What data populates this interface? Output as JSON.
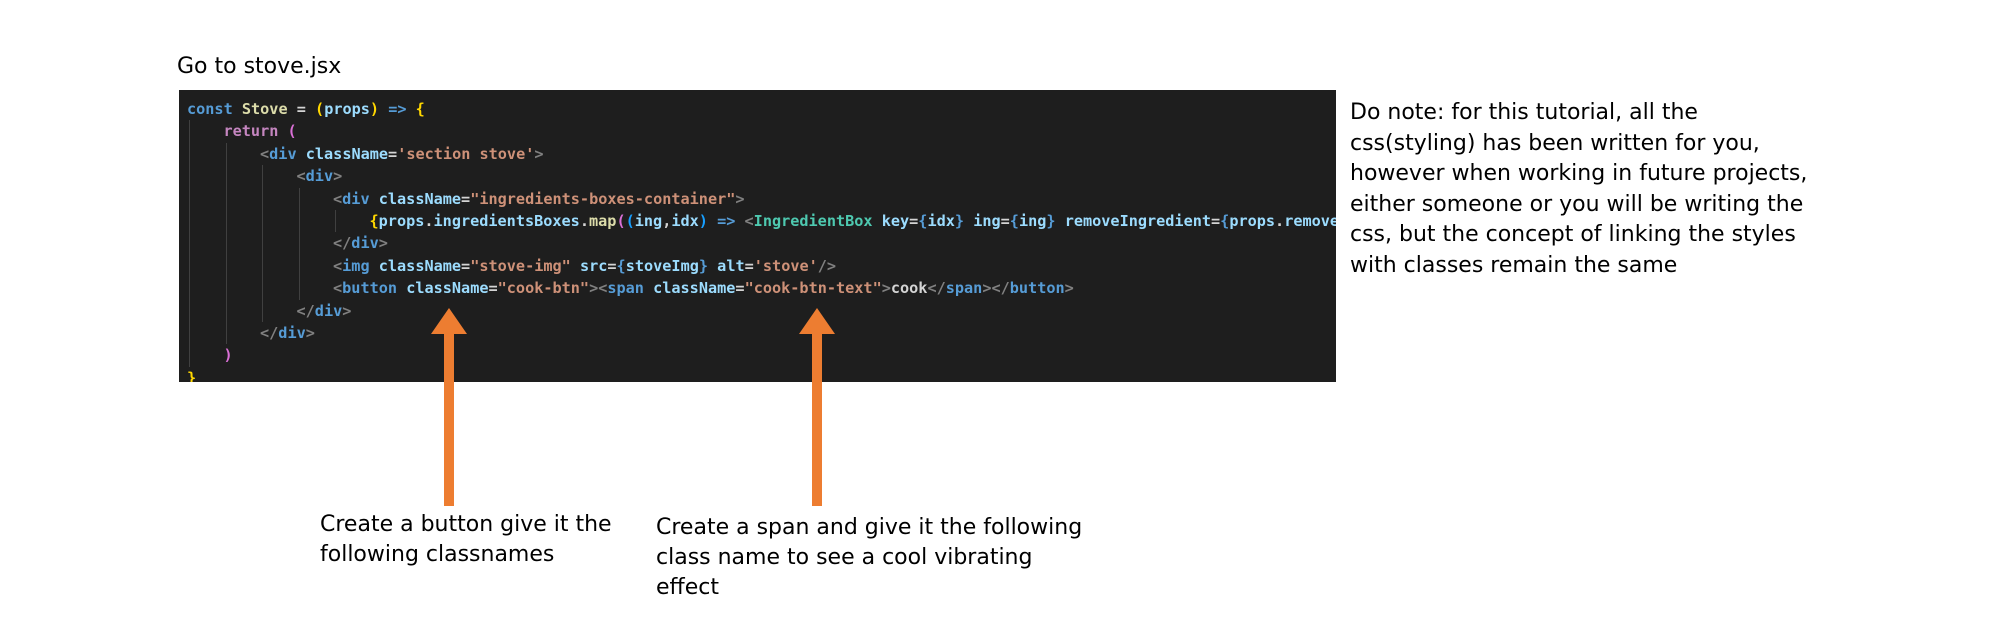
{
  "heading": "Go to stove.jsx",
  "code_lines": [
    {
      "indent": 0,
      "tokens": [
        {
          "t": "const ",
          "c": "#569cd6"
        },
        {
          "t": "Stove",
          "c": "#dcdcaa"
        },
        {
          "t": " = ",
          "c": "#d4d4d4"
        },
        {
          "t": "(",
          "c": "#ffd700"
        },
        {
          "t": "props",
          "c": "#9cdcfe"
        },
        {
          "t": ")",
          "c": "#ffd700"
        },
        {
          "t": " => ",
          "c": "#569cd6"
        },
        {
          "t": "{",
          "c": "#ffd700"
        }
      ]
    },
    {
      "indent": 1,
      "tokens": [
        {
          "t": "return",
          "c": "#c586c0"
        },
        {
          "t": " ",
          "c": "#d4d4d4"
        },
        {
          "t": "(",
          "c": "#da70d6"
        }
      ]
    },
    {
      "indent": 2,
      "tokens": [
        {
          "t": "<",
          "c": "#808080"
        },
        {
          "t": "div",
          "c": "#569cd6"
        },
        {
          "t": " ",
          "c": "#d4d4d4"
        },
        {
          "t": "className",
          "c": "#9cdcfe"
        },
        {
          "t": "=",
          "c": "#d4d4d4"
        },
        {
          "t": "'section stove'",
          "c": "#ce9178"
        },
        {
          "t": ">",
          "c": "#808080"
        }
      ]
    },
    {
      "indent": 3,
      "tokens": [
        {
          "t": "<",
          "c": "#808080"
        },
        {
          "t": "div",
          "c": "#569cd6"
        },
        {
          "t": ">",
          "c": "#808080"
        }
      ]
    },
    {
      "indent": 4,
      "tokens": [
        {
          "t": "<",
          "c": "#808080"
        },
        {
          "t": "div",
          "c": "#569cd6"
        },
        {
          "t": " ",
          "c": "#d4d4d4"
        },
        {
          "t": "className",
          "c": "#9cdcfe"
        },
        {
          "t": "=",
          "c": "#d4d4d4"
        },
        {
          "t": "\"ingredients-boxes-container\"",
          "c": "#ce9178"
        },
        {
          "t": ">",
          "c": "#808080"
        }
      ]
    },
    {
      "indent": 5,
      "tokens": [
        {
          "t": "{",
          "c": "#ffd700"
        },
        {
          "t": "props",
          "c": "#9cdcfe"
        },
        {
          "t": ".",
          "c": "#d4d4d4"
        },
        {
          "t": "ingredientsBoxes",
          "c": "#9cdcfe"
        },
        {
          "t": ".",
          "c": "#d4d4d4"
        },
        {
          "t": "map",
          "c": "#dcdcaa"
        },
        {
          "t": "(",
          "c": "#da70d6"
        },
        {
          "t": "(",
          "c": "#179fff"
        },
        {
          "t": "ing",
          "c": "#9cdcfe"
        },
        {
          "t": ",",
          "c": "#d4d4d4"
        },
        {
          "t": "idx",
          "c": "#9cdcfe"
        },
        {
          "t": ")",
          "c": "#179fff"
        },
        {
          "t": " => ",
          "c": "#569cd6"
        },
        {
          "t": "<",
          "c": "#808080"
        },
        {
          "t": "IngredientBox",
          "c": "#4ec9b0"
        },
        {
          "t": " ",
          "c": "#d4d4d4"
        },
        {
          "t": "key",
          "c": "#9cdcfe"
        },
        {
          "t": "=",
          "c": "#d4d4d4"
        },
        {
          "t": "{",
          "c": "#569cd6"
        },
        {
          "t": "idx",
          "c": "#9cdcfe"
        },
        {
          "t": "}",
          "c": "#569cd6"
        },
        {
          "t": " ",
          "c": "#d4d4d4"
        },
        {
          "t": "ing",
          "c": "#9cdcfe"
        },
        {
          "t": "=",
          "c": "#d4d4d4"
        },
        {
          "t": "{",
          "c": "#569cd6"
        },
        {
          "t": "ing",
          "c": "#9cdcfe"
        },
        {
          "t": "}",
          "c": "#569cd6"
        },
        {
          "t": " ",
          "c": "#d4d4d4"
        },
        {
          "t": "removeIngredient",
          "c": "#9cdcfe"
        },
        {
          "t": "=",
          "c": "#d4d4d4"
        },
        {
          "t": "{",
          "c": "#569cd6"
        },
        {
          "t": "props",
          "c": "#9cdcfe"
        },
        {
          "t": ".",
          "c": "#d4d4d4"
        },
        {
          "t": "removeIngredient",
          "c": "#9cdcfe"
        }
      ]
    },
    {
      "indent": 4,
      "tokens": [
        {
          "t": "</",
          "c": "#808080"
        },
        {
          "t": "div",
          "c": "#569cd6"
        },
        {
          "t": ">",
          "c": "#808080"
        }
      ]
    },
    {
      "indent": 4,
      "tokens": [
        {
          "t": "<",
          "c": "#808080"
        },
        {
          "t": "img",
          "c": "#569cd6"
        },
        {
          "t": " ",
          "c": "#d4d4d4"
        },
        {
          "t": "className",
          "c": "#9cdcfe"
        },
        {
          "t": "=",
          "c": "#d4d4d4"
        },
        {
          "t": "\"stove-img\"",
          "c": "#ce9178"
        },
        {
          "t": " ",
          "c": "#d4d4d4"
        },
        {
          "t": "src",
          "c": "#9cdcfe"
        },
        {
          "t": "=",
          "c": "#d4d4d4"
        },
        {
          "t": "{",
          "c": "#569cd6"
        },
        {
          "t": "stoveImg",
          "c": "#9cdcfe"
        },
        {
          "t": "}",
          "c": "#569cd6"
        },
        {
          "t": " ",
          "c": "#d4d4d4"
        },
        {
          "t": "alt",
          "c": "#9cdcfe"
        },
        {
          "t": "=",
          "c": "#d4d4d4"
        },
        {
          "t": "'stove'",
          "c": "#ce9178"
        },
        {
          "t": "/>",
          "c": "#808080"
        }
      ]
    },
    {
      "indent": 4,
      "tokens": [
        {
          "t": "<",
          "c": "#808080"
        },
        {
          "t": "button",
          "c": "#569cd6"
        },
        {
          "t": " ",
          "c": "#d4d4d4"
        },
        {
          "t": "className",
          "c": "#9cdcfe"
        },
        {
          "t": "=",
          "c": "#d4d4d4"
        },
        {
          "t": "\"cook-btn\"",
          "c": "#ce9178"
        },
        {
          "t": "><",
          "c": "#808080"
        },
        {
          "t": "span",
          "c": "#569cd6"
        },
        {
          "t": " ",
          "c": "#d4d4d4"
        },
        {
          "t": "className",
          "c": "#9cdcfe"
        },
        {
          "t": "=",
          "c": "#d4d4d4"
        },
        {
          "t": "\"cook-btn-text\"",
          "c": "#ce9178"
        },
        {
          "t": ">",
          "c": "#808080"
        },
        {
          "t": "cook",
          "c": "#d4d4d4"
        },
        {
          "t": "</",
          "c": "#808080"
        },
        {
          "t": "span",
          "c": "#569cd6"
        },
        {
          "t": "></",
          "c": "#808080"
        },
        {
          "t": "button",
          "c": "#569cd6"
        },
        {
          "t": ">",
          "c": "#808080"
        }
      ]
    },
    {
      "indent": 3,
      "tokens": [
        {
          "t": "</",
          "c": "#808080"
        },
        {
          "t": "div",
          "c": "#569cd6"
        },
        {
          "t": ">",
          "c": "#808080"
        }
      ]
    },
    {
      "indent": 2,
      "tokens": [
        {
          "t": "</",
          "c": "#808080"
        },
        {
          "t": "div",
          "c": "#569cd6"
        },
        {
          "t": ">",
          "c": "#808080"
        }
      ]
    },
    {
      "indent": 1,
      "tokens": [
        {
          "t": ")",
          "c": "#da70d6"
        }
      ]
    },
    {
      "indent": 0,
      "tokens": [
        {
          "t": "}",
          "c": "#ffd700"
        }
      ]
    }
  ],
  "note": "Do note: for this tutorial, all the css(styling) has been written for you, however when working in future projects, either someone or you will be writing the css, but the concept of linking the styles with classes remain the same",
  "caption_button": "Create a button give it the following classnames",
  "caption_span": "Create a span and give it the following class name to see a cool vibrating effect",
  "colors": {
    "code_background": "#1e1e1e",
    "arrow": "#ed7d31"
  }
}
